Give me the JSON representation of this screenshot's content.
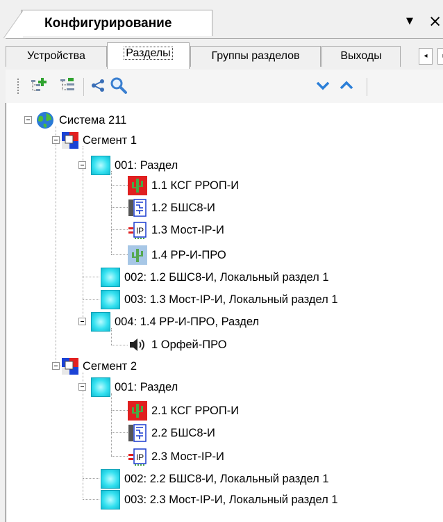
{
  "panel": {
    "title": "Конфигурирование",
    "pin_glyph": "▼",
    "close_glyph": "×"
  },
  "tabs": [
    {
      "label": "Устройства",
      "active": false
    },
    {
      "label": "Разделы",
      "active": true
    },
    {
      "label": "Группы разделов",
      "active": false
    },
    {
      "label": "Выходы",
      "active": false
    }
  ],
  "tab_scroll": {
    "left_glyph": "◂",
    "right_glyph": "▸"
  },
  "toolbar": {
    "buttons": [
      "add-partition-icon",
      "partition-list-icon",
      "tree-connect-icon",
      "search-icon",
      "move-down-icon",
      "move-up-icon"
    ]
  },
  "tree": {
    "root": {
      "label": "Система 211",
      "icon": "globe-icon"
    },
    "segment1": {
      "label": "Сегмент 1",
      "partition1": {
        "label": "001: Раздел",
        "devices": [
          {
            "label": "1.1 КСГ РРОП-И",
            "icon": "ksg-device-icon"
          },
          {
            "label": "1.2 БШС8-И",
            "icon": "bshs-device-icon"
          },
          {
            "label": "1.3 Мост-IP-И",
            "icon": "ip-bridge-icon"
          },
          {
            "label": "1.4 РР-И-ПРО",
            "icon": "rr-device-icon"
          }
        ]
      },
      "partition2": {
        "label": "002: 1.2 БШС8-И, Локальный раздел 1"
      },
      "partition3": {
        "label": "003: 1.3 Мост-IP-И, Локальный раздел 1"
      },
      "partition4": {
        "label": "004: 1.4 РР-И-ПРО, Раздел",
        "devices": [
          {
            "label": "1 Орфей-ПРО",
            "icon": "speaker-icon"
          }
        ]
      }
    },
    "segment2": {
      "label": "Сегмент 2",
      "partition1": {
        "label": "001: Раздел",
        "devices": [
          {
            "label": "2.1 КСГ РРОП-И",
            "icon": "ksg-device-icon"
          },
          {
            "label": "2.2 БШС8-И",
            "icon": "bshs-device-icon"
          },
          {
            "label": "2.3 Мост-IP-И",
            "icon": "ip-bridge-icon"
          }
        ]
      },
      "partition2": {
        "label": "002: 2.2 БШС8-И, Локальный раздел 1"
      },
      "partition3": {
        "label": "003: 2.3 Мост-IP-И, Локальный раздел 1"
      }
    }
  }
}
